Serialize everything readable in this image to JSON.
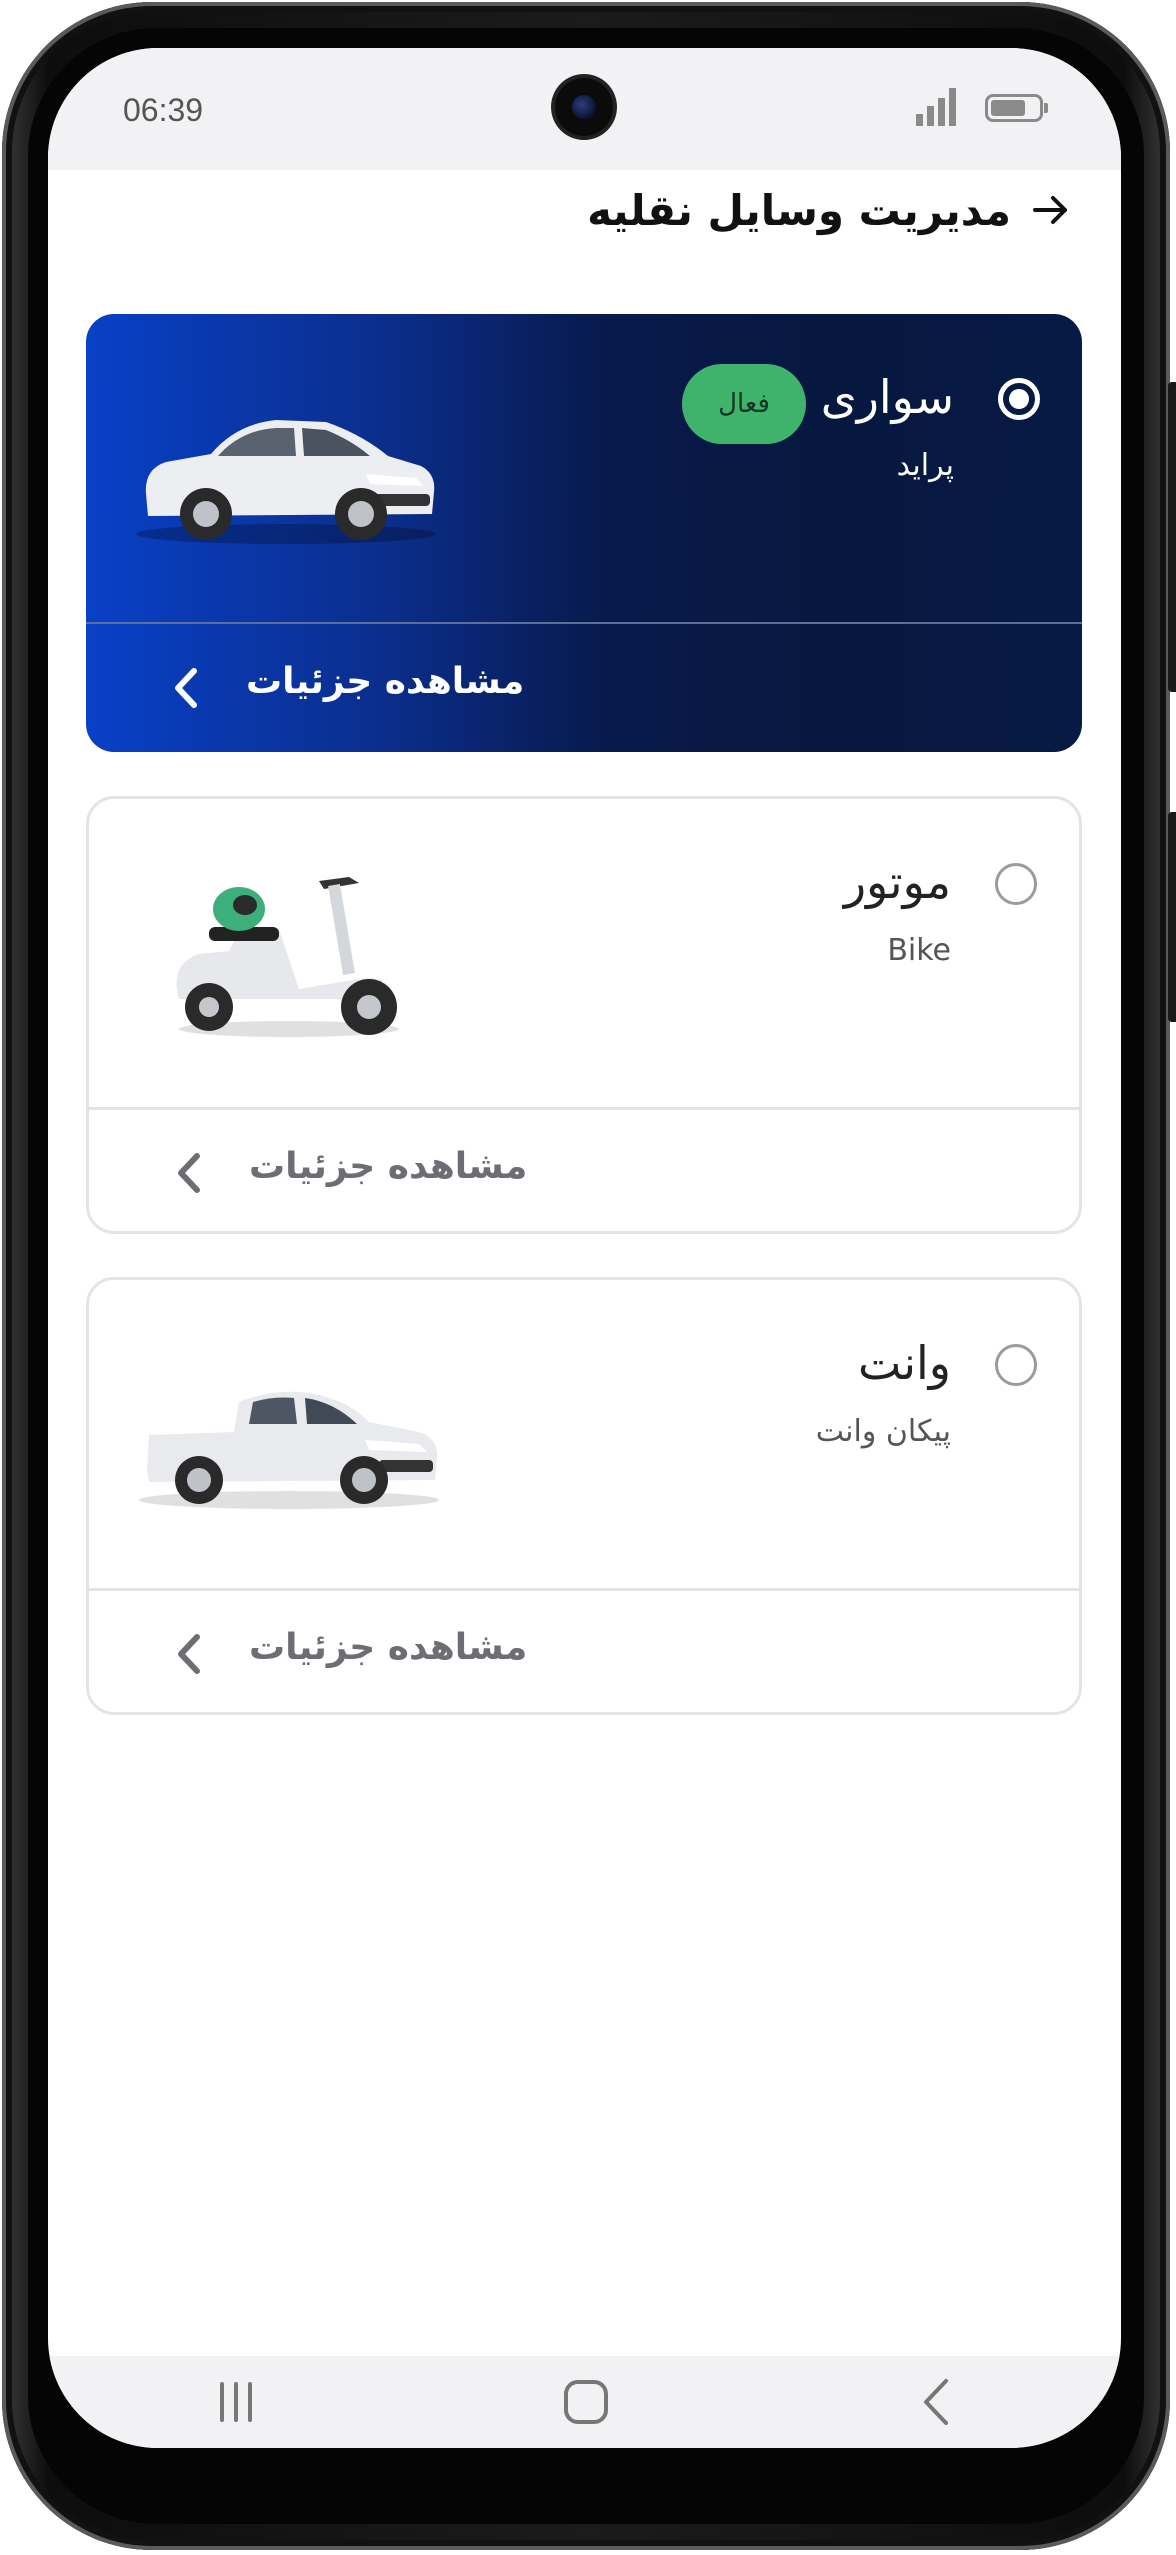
{
  "status_bar": {
    "time": "06:39"
  },
  "header": {
    "title": "مدیریت وسایل نقلیه"
  },
  "vehicles": [
    {
      "title": "سواری",
      "subtitle": "پراید",
      "badge": "فعال",
      "selected": true,
      "details_label": "مشاهده جزئیات",
      "icon": "sedan-car"
    },
    {
      "title": "موتور",
      "subtitle": "Bike",
      "selected": false,
      "details_label": "مشاهده جزئیات",
      "icon": "scooter"
    },
    {
      "title": "وانت",
      "subtitle": "پیکان وانت",
      "selected": false,
      "details_label": "مشاهده جزئیات",
      "icon": "pickup-truck"
    }
  ],
  "colors": {
    "active_card_start": "#0840c7",
    "active_card_end": "#071a45",
    "badge": "#3fb36b"
  }
}
